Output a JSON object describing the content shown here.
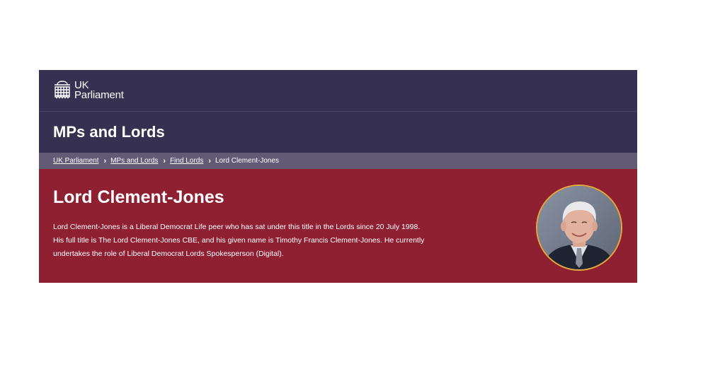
{
  "header": {
    "logo_line1": "UK",
    "logo_line2": "Parliament",
    "logo_icon": "portcullis-icon"
  },
  "section": {
    "title": "MPs and Lords"
  },
  "breadcrumb": {
    "items": [
      {
        "label": "UK Parliament"
      },
      {
        "label": "MPs and Lords"
      },
      {
        "label": "Find Lords"
      }
    ],
    "current": "Lord Clement-Jones",
    "separator_icon": "chevron-right-icon"
  },
  "member": {
    "name": "Lord Clement-Jones",
    "bio": "Lord Clement-Jones is a Liberal Democrat Life peer who has sat under this title in the Lords since 20 July 1998. His full title is The Lord Clement-Jones CBE, and his given name is Timothy Francis Clement-Jones. He currently undertakes the role of Liberal Democrat Lords Spokesperson (Digital).",
    "portrait_icon": "portrait-photo"
  },
  "colors": {
    "header_bg": "#373151",
    "breadcrumb_bg": "#615b76",
    "hero_bg": "#8e2032",
    "portrait_border": "#e6a93c"
  }
}
